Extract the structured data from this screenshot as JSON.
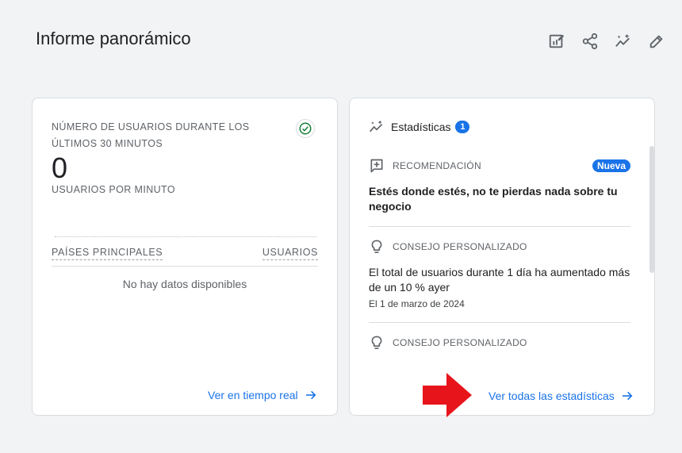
{
  "page": {
    "title": "Informe panorámico"
  },
  "toolbar": {
    "icons": [
      "edit-report-icon",
      "share-icon",
      "insights-icon",
      "pencil-icon"
    ]
  },
  "realtime_card": {
    "title": "NÚMERO DE USUARIOS DURANTE LOS ÚLTIMOS 30 MINUTOS",
    "value": "0",
    "unit": "USUARIOS POR MINUTO",
    "table_headers": [
      "PAÍSES PRINCIPALES",
      "USUARIOS"
    ],
    "empty_message": "No hay datos disponibles",
    "link_label": "Ver en tiempo real"
  },
  "insights_card": {
    "title": "Estadísticas",
    "count": "1",
    "items": [
      {
        "kind": "RECOMENDACIÓN",
        "badge": "Nueva",
        "text": "Estés donde estés, no te pierdas nada sobre tu negocio"
      },
      {
        "kind": "CONSEJO PERSONALIZADO",
        "text": "El total de usuarios durante 1 día ha aumentado más de un 10 % ayer",
        "date": "El 1 de marzo de 2024"
      },
      {
        "kind": "CONSEJO PERSONALIZADO"
      }
    ],
    "link_label": "Ver todas las estadísticas"
  },
  "colors": {
    "accent": "#1a73e8",
    "success": "#188038",
    "annotation": "#e8141b"
  }
}
